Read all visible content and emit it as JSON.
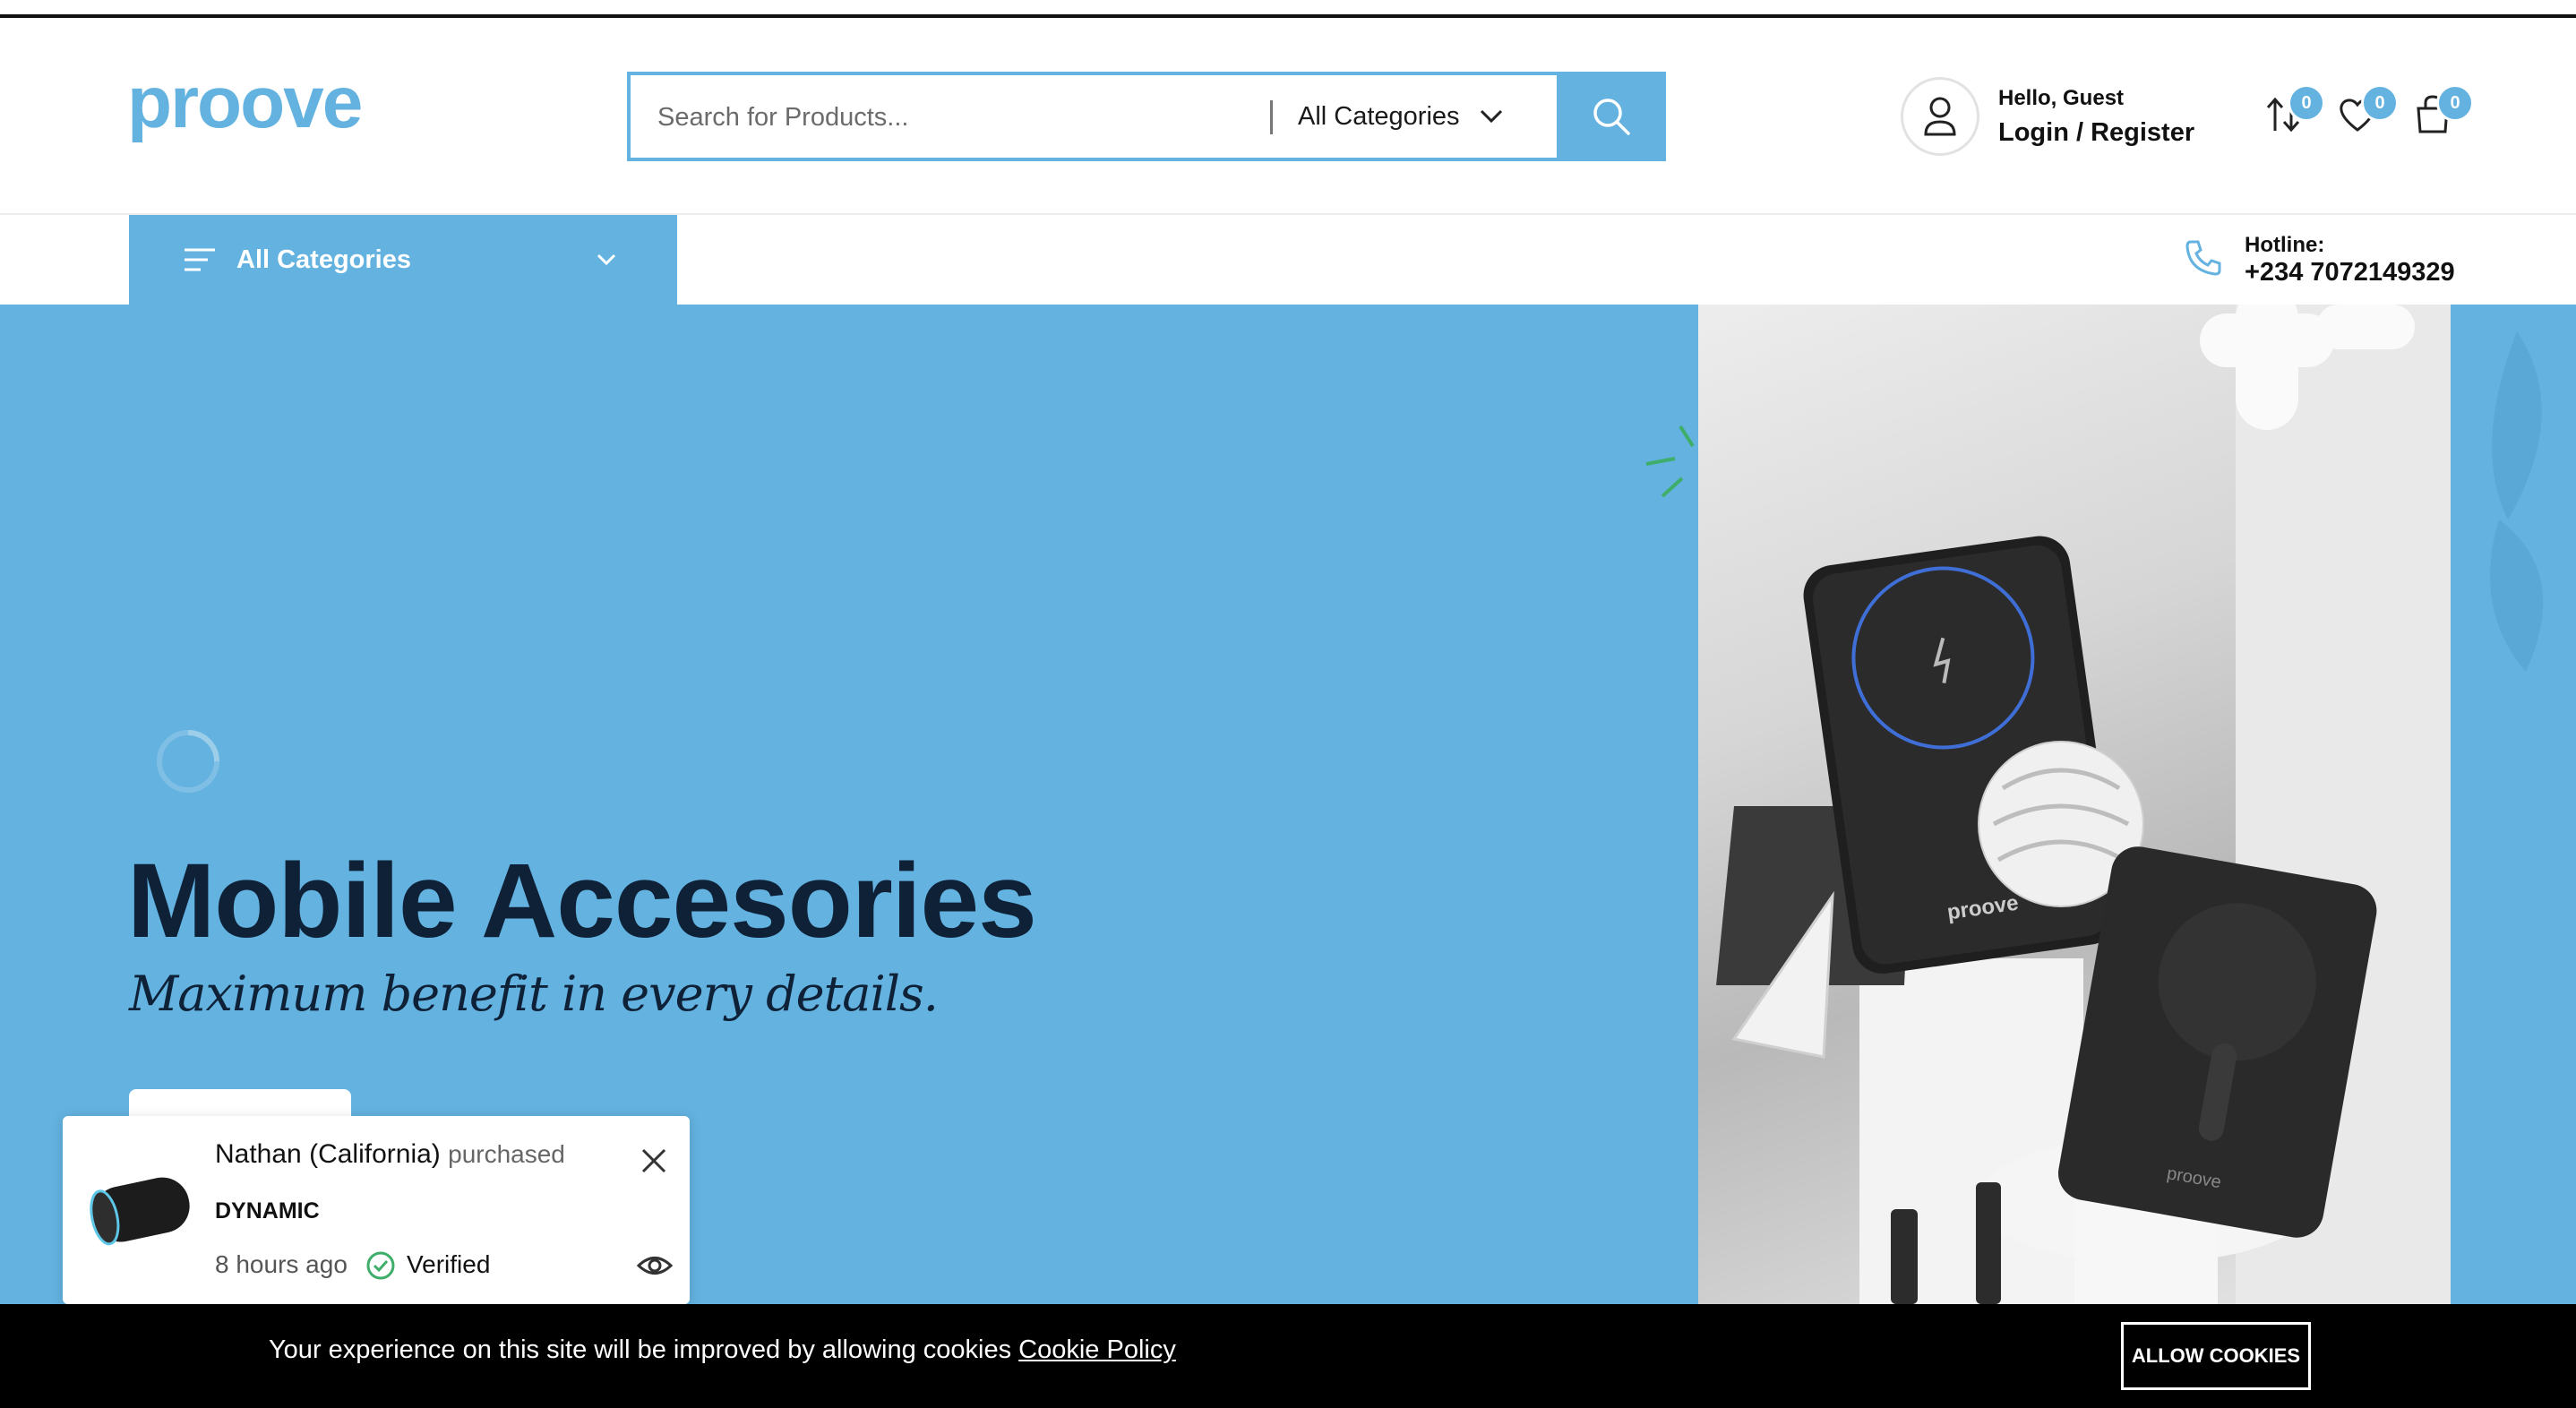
{
  "colors": {
    "accent": "#63b2e0",
    "dark_text": "#0e2137",
    "cookie_bg": "#000000"
  },
  "header": {
    "logo_text": "proove",
    "search": {
      "placeholder": "Search for Products...",
      "category": "All Categories",
      "search_icon": "search-icon"
    },
    "account": {
      "greeting": "Hello, Guest",
      "login_label": "Login / Register",
      "icon": "user-icon"
    },
    "icons": [
      {
        "icon": "compare-arrows-icon",
        "count": "0"
      },
      {
        "icon": "heart-icon",
        "count": "0"
      },
      {
        "icon": "shopping-bag-icon",
        "count": "0"
      }
    ]
  },
  "nav": {
    "all_categories": "All Categories",
    "hotline_label": "Hotline:",
    "hotline_number": "+234 7072149329"
  },
  "hero": {
    "title": "Mobile Accesories",
    "subtitle": "Maximum benefit in every details."
  },
  "toast": {
    "buyer": "Nathan (California)",
    "action": "purchased",
    "product": "DYNAMIC",
    "time": "8 hours ago",
    "verified": "Verified"
  },
  "cookie": {
    "text": "Your experience on this site will be improved by allowing cookies",
    "link": "Cookie Policy",
    "button": "ALLOW COOKIES"
  }
}
